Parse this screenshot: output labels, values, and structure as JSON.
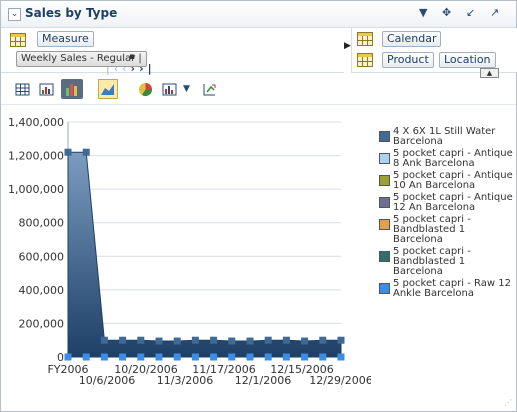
{
  "panel": {
    "title": "Sales by Type"
  },
  "titlebar": {
    "menu_icon": "dropdown-triangle-icon",
    "move_icon": "move-icon",
    "minimize_icon": "minimize-icon",
    "maximize_icon": "maximize-icon"
  },
  "filters": {
    "measure_label": "Measure",
    "measure_value": "Weekly Sales - Regular",
    "right": {
      "calendar": "Calendar",
      "product": "Product",
      "location": "Location"
    }
  },
  "toolbar": {
    "icons": [
      "table-view-icon",
      "chart-table-view-icon",
      "chart-view-icon",
      "area-chart-icon",
      "pie-chart-icon",
      "chart-type-icon",
      "dropdown-icon",
      "swap-axes-icon"
    ]
  },
  "chart_data": {
    "type": "area",
    "title": "",
    "xlabel": "",
    "ylabel": "",
    "ylim": [
      0,
      1400000
    ],
    "yticks": [
      "0",
      "200,000",
      "400,000",
      "600,000",
      "800,000",
      "1,000,000",
      "1,200,000",
      "1,400,000"
    ],
    "xticks": [
      "FY2006",
      "10/6/2006",
      "10/20/2006",
      "11/3/2006",
      "11/17/2006",
      "12/1/2006",
      "12/15/2006",
      "12/29/2006"
    ],
    "grid": true,
    "legend_position": "right",
    "series": [
      {
        "name": "4 X 6X 1L Still Water Barcelona",
        "color": "#3e6a95",
        "values": [
          1220000,
          1220000,
          100000,
          100000,
          100000,
          95000,
          95000,
          100000,
          100000,
          95000,
          95000,
          100000,
          100000,
          95000,
          100000,
          100000
        ]
      },
      {
        "name": "5 pocket capri - Antique 8 Ank Barcelona",
        "color": "#a8d4f4",
        "values": [
          0,
          0,
          0,
          0,
          0,
          0,
          0,
          0,
          0,
          0,
          0,
          0,
          0,
          0,
          0,
          0
        ]
      },
      {
        "name": "5 pocket capri - Antique 10 An Barcelona",
        "color": "#9aa033",
        "values": [
          0,
          0,
          0,
          0,
          0,
          0,
          0,
          0,
          0,
          0,
          0,
          0,
          0,
          0,
          0,
          0
        ]
      },
      {
        "name": "5 pocket capri - Antique 12 An Barcelona",
        "color": "#6f6d95",
        "values": [
          0,
          0,
          0,
          0,
          0,
          0,
          0,
          0,
          0,
          0,
          0,
          0,
          0,
          0,
          0,
          0
        ]
      },
      {
        "name": "5 pocket capri - Bandblasted 1 Barcelona",
        "color": "#e0a050",
        "values": [
          0,
          0,
          0,
          0,
          0,
          0,
          0,
          0,
          0,
          0,
          0,
          0,
          0,
          0,
          0,
          0
        ]
      },
      {
        "name": "5 pocket capri - Bandblasted 1 Barcelona",
        "color": "#2f6f66",
        "values": [
          0,
          0,
          0,
          0,
          0,
          0,
          0,
          0,
          0,
          0,
          0,
          0,
          0,
          0,
          0,
          0
        ]
      },
      {
        "name": "5 pocket capri - Raw 12 Ankle Barcelona",
        "color": "#3a8ee8",
        "values": [
          0,
          0,
          0,
          0,
          0,
          0,
          0,
          0,
          0,
          0,
          0,
          0,
          0,
          0,
          0,
          0
        ]
      }
    ]
  }
}
